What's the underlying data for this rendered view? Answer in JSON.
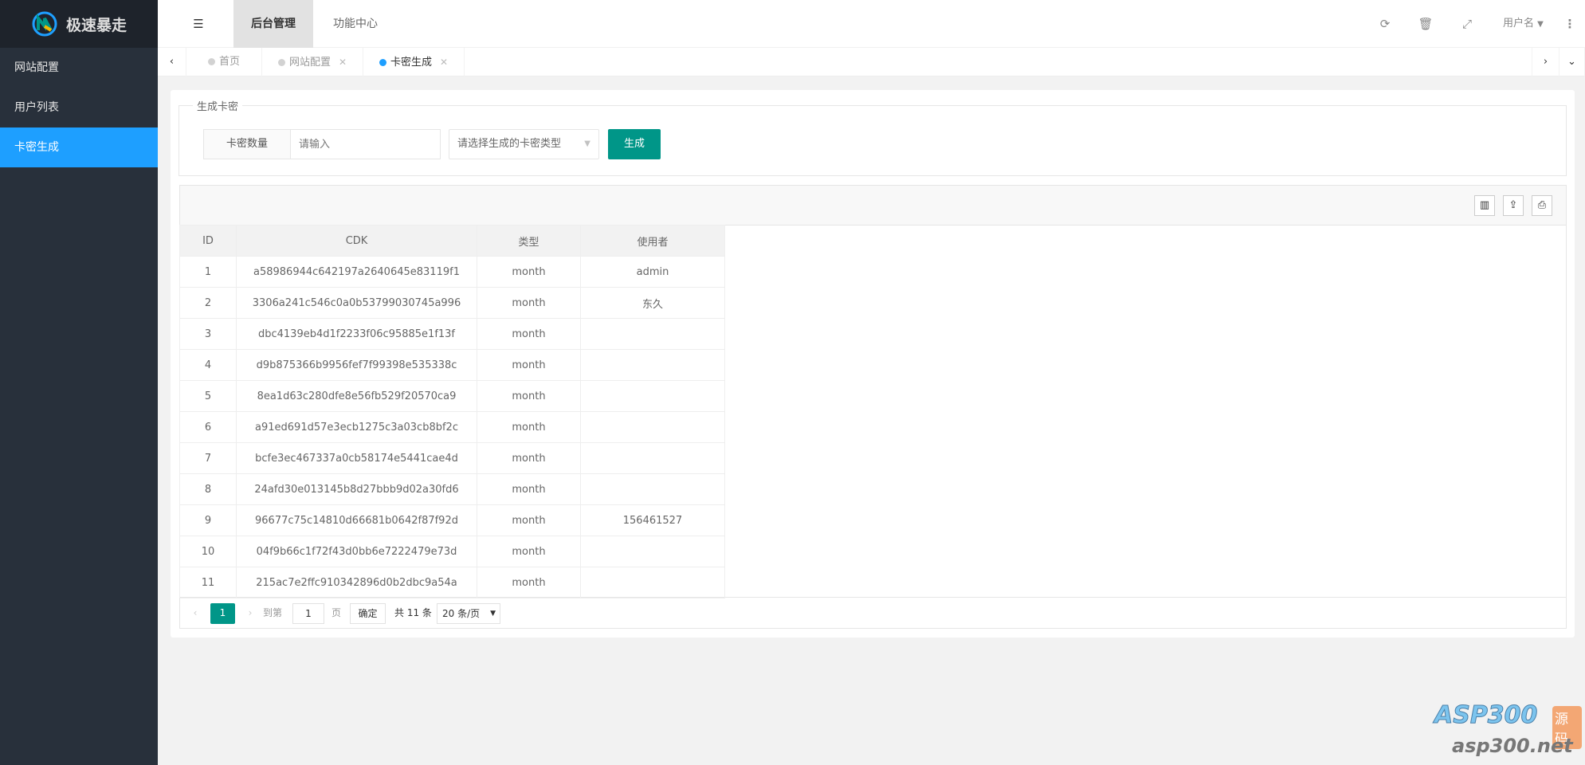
{
  "brand": {
    "name": "极速暴走"
  },
  "sidebar": {
    "items": [
      {
        "label": "网站配置"
      },
      {
        "label": "用户列表"
      },
      {
        "label": "卡密生成"
      }
    ]
  },
  "header": {
    "tabs": [
      {
        "label": "后台管理"
      },
      {
        "label": "功能中心"
      }
    ],
    "user": "用户名"
  },
  "page_tabs": [
    {
      "label": "首页"
    },
    {
      "label": "网站配置"
    },
    {
      "label": "卡密生成"
    }
  ],
  "form": {
    "legend": "生成卡密",
    "qty_label": "卡密数量",
    "qty_placeholder": "请输入",
    "type_placeholder": "请选择生成的卡密类型",
    "submit": "生成"
  },
  "table": {
    "columns": [
      "ID",
      "CDK",
      "类型",
      "使用者"
    ],
    "rows": [
      [
        "1",
        "a58986944c642197a2640645e83119f1",
        "month",
        "admin"
      ],
      [
        "2",
        "3306a241c546c0a0b53799030745a996",
        "month",
        "东久"
      ],
      [
        "3",
        "dbc4139eb4d1f2233f06c95885e1f13f",
        "month",
        ""
      ],
      [
        "4",
        "d9b875366b9956fef7f99398e535338c",
        "month",
        ""
      ],
      [
        "5",
        "8ea1d63c280dfe8e56fb529f20570ca9",
        "month",
        ""
      ],
      [
        "6",
        "a91ed691d57e3ecb1275c3a03cb8bf2c",
        "month",
        ""
      ],
      [
        "7",
        "bcfe3ec467337a0cb58174e5441cae4d",
        "month",
        ""
      ],
      [
        "8",
        "24afd30e013145b8d27bbb9d02a30fd6",
        "month",
        ""
      ],
      [
        "9",
        "96677c75c14810d66681b0642f87f92d",
        "month",
        "156461527"
      ],
      [
        "10",
        "04f9b66c1f72f43d0bb6e7222479e73d",
        "month",
        ""
      ],
      [
        "11",
        "215ac7e2ffc910342896d0b2dbc9a54a",
        "month",
        ""
      ]
    ]
  },
  "pagination": {
    "current": "1",
    "goto_label": "到第",
    "goto_value": "1",
    "page_label": "页",
    "confirm": "确定",
    "total": "共 11 条",
    "per_page": "20 条/页"
  },
  "watermark": {
    "text1": "ASP300",
    "text2": "源码",
    "text3": "asp300.net"
  },
  "colors": {
    "accent": "#1e9fff",
    "primary": "#009688",
    "sidebar": "#28303b"
  }
}
